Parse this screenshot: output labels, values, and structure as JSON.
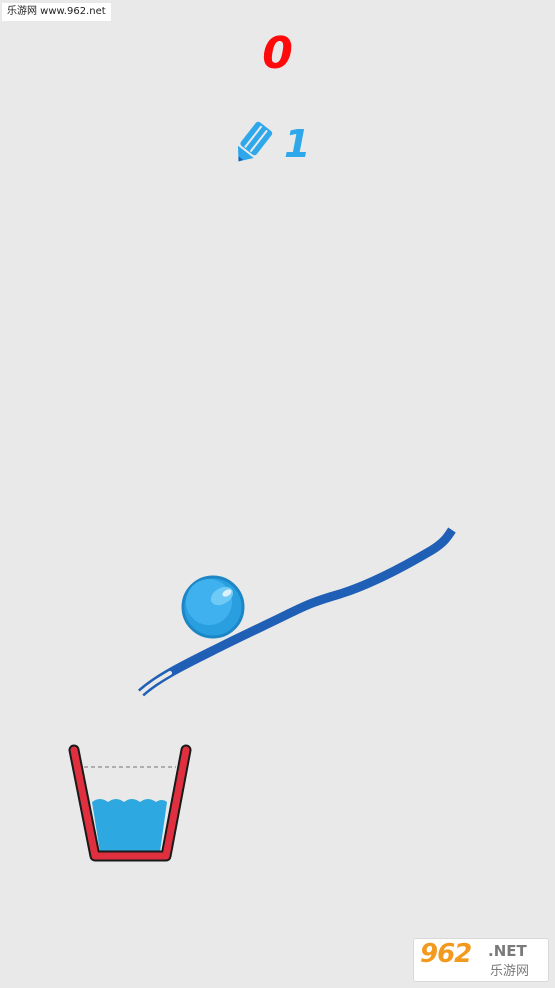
{
  "watermark": {
    "text": "乐游网 www.962.net"
  },
  "hud": {
    "score": "0",
    "pencils_left": "1"
  },
  "scene": {
    "ball": "ball",
    "cup_water_level": 0.45
  },
  "badge": {
    "logo": "962",
    "suffix": ".NET",
    "cn_text": "乐游网"
  },
  "colors": {
    "background": "#e9e9e9",
    "score": "#ff0a0a",
    "pencil": "#2ea8ea",
    "ink_line": "#1f5fb5",
    "ball": "#2ea8ea",
    "cup": "#e03040",
    "water": "#2ea8e0"
  }
}
